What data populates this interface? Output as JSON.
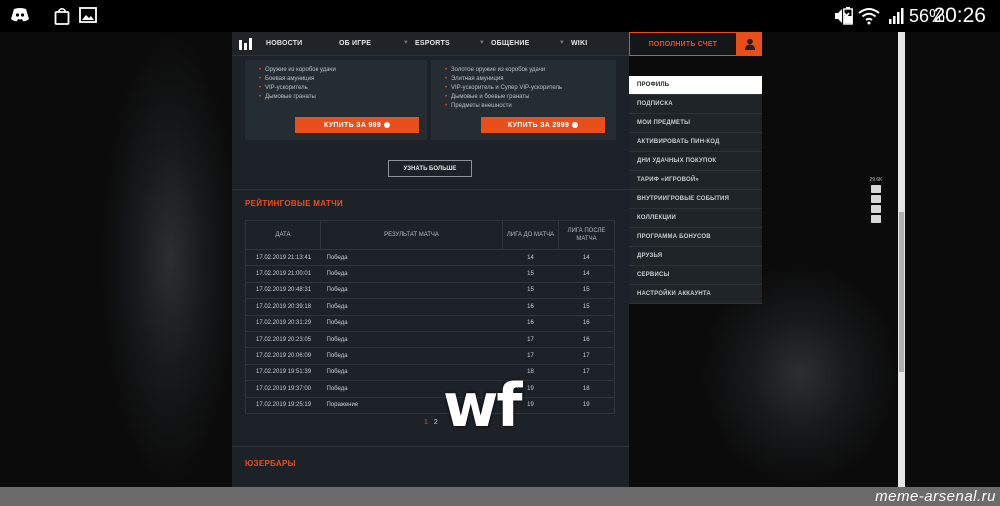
{
  "status_bar": {
    "left_icons": [
      "discord-icon",
      "shopping-bag-icon",
      "image-icon"
    ],
    "right_icons": [
      "mute-icon",
      "wifi-icon",
      "signal-icon",
      "battery-icon"
    ],
    "battery": "56%",
    "time": "20:26"
  },
  "nav": {
    "items": [
      "НОВОСТИ",
      "ОБ ИГРЕ",
      "ESPORTS",
      "ОБЩЕНИЕ",
      "WIKI"
    ]
  },
  "offers": {
    "left": {
      "items": [
        "Оружие из коробок удачи",
        "Боевая амуниция",
        "VIP-ускоритель",
        "Дымовые гранаты"
      ],
      "button": "КУПИТЬ ЗА 999"
    },
    "right": {
      "items": [
        "Золотое оружие из коробок удачи",
        "Элитная амуниция",
        "VIP-ускоритель и Супер VIP-ускоритель",
        "Дымовые и боевые гранаты",
        "Предметы внешности"
      ],
      "button": "КУПИТЬ ЗА 2999"
    },
    "learn_more": "УЗНАТЬ БОЛЬШЕ"
  },
  "ranked": {
    "title": "РЕЙТИНГОВЫЕ МАТЧИ",
    "columns": [
      "ДАТА",
      "РЕЗУЛЬТАТ МАТЧА",
      "ЛИГА ДО МАТЧА",
      "ЛИГА ПОСЛЕ МАТЧА"
    ],
    "rows": [
      [
        "17.02.2019 21:13:41",
        "Победа",
        "14",
        "14"
      ],
      [
        "17.02.2019 21:00:01",
        "Победа",
        "15",
        "14"
      ],
      [
        "17.02.2019 20:48:31",
        "Победа",
        "15",
        "15"
      ],
      [
        "17.02.2019 20:39:18",
        "Победа",
        "16",
        "15"
      ],
      [
        "17.02.2019 20:31:29",
        "Победа",
        "16",
        "16"
      ],
      [
        "17.02.2019 20:23:05",
        "Победа",
        "17",
        "16"
      ],
      [
        "17.02.2019 20:06:09",
        "Победа",
        "17",
        "17"
      ],
      [
        "17.02.2019 19:51:39",
        "Победа",
        "18",
        "17"
      ],
      [
        "17.02.2019 19:37:00",
        "Победа",
        "19",
        "18"
      ],
      [
        "17.02.2019 19:25:19",
        "Поражение",
        "19",
        "19"
      ]
    ],
    "pages": [
      "1",
      "2"
    ]
  },
  "userbars": {
    "title": "ЮЗЕРБАРЫ"
  },
  "account": {
    "topup": "ПОПОЛНИТЬ СЧЕТ",
    "menu": [
      "ПРОФИЛЬ",
      "ПОДПИСКА",
      "МОИ ПРЕДМЕТЫ",
      "АКТИВИРОВАТЬ ПИН-КОД",
      "ДНИ УДАЧНЫХ ПОКУПОК",
      "ТАРИФ «ИГРОВОЙ»",
      "ВНУТРИИГРОВЫЕ СОБЫТИЯ",
      "КОЛЛЕКЦИИ",
      "ПРОГРАММА БОНУСОВ",
      "ДРУЗЬЯ",
      "СЕРВИСЫ",
      "НАСТРОЙКИ АККАУНТА"
    ]
  },
  "share": {
    "count": "29.6K"
  },
  "caption": "wf",
  "watermark": "meme-arsenal.ru",
  "colors": {
    "accent": "#e84f1a",
    "panel": "#1c2227"
  }
}
